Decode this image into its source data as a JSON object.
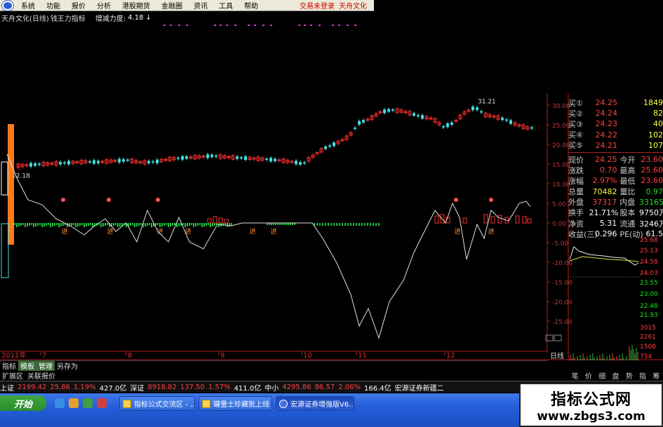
{
  "menu": {
    "items": [
      "系统",
      "功能",
      "报价",
      "分析",
      "港股期货",
      "金融圈",
      "资讯",
      "工具",
      "帮助"
    ],
    "right": [
      "交易未登录",
      "天舟文化"
    ]
  },
  "title": {
    "stock": "天舟文化(日线)",
    "indicator": "钱王力指标",
    "label": "增减力度:",
    "value": "4.18",
    "arrow": "↓"
  },
  "chart": {
    "price_high": "31.21",
    "price_low": "12.18",
    "axis_ticks": [
      "30.00",
      "25.00",
      "20.00",
      "15.00",
      "10.00",
      "5.00",
      "0.00",
      "-5.00",
      "-10.00",
      "-15.00",
      "-20.00",
      "-25.00"
    ],
    "year": "2011年",
    "months": [
      "7",
      "8",
      "9",
      "10",
      "11",
      "12"
    ],
    "period": "日线",
    "buy_marker": "进"
  },
  "quote": {
    "rows": [
      {
        "l": "买①",
        "v": "24.25",
        "c": "1849"
      },
      {
        "l": "买②",
        "v": "24.24",
        "c": "82"
      },
      {
        "l": "买③",
        "v": "24.23",
        "c": "40"
      },
      {
        "l": "买④",
        "v": "24.22",
        "c": "102"
      },
      {
        "l": "买⑤",
        "v": "24.21",
        "c": "107"
      }
    ],
    "stats": [
      {
        "l": "现价",
        "v": "24.25",
        "l2": "今开",
        "v2": "23.60"
      },
      {
        "l": "涨跌",
        "v": "0.70",
        "l2": "最高",
        "v2": "25.60"
      },
      {
        "l": "涨幅",
        "v": "2.97%",
        "l2": "最低",
        "v2": "23.60"
      },
      {
        "l": "总量",
        "v": "70482",
        "l2": "量比",
        "v2": "0.97"
      },
      {
        "l": "外盘",
        "v": "37317",
        "l2": "内盘",
        "v2": "33165"
      },
      {
        "l": "换手",
        "v": "21.71%",
        "l2": "股本",
        "v2": "9750万"
      },
      {
        "l": "净资",
        "v": "5.31",
        "l2": "流通",
        "v2": "3246万"
      },
      {
        "l": "收益(三)",
        "v": "0.296",
        "l2": "PE(动)",
        "v2": "61.5"
      }
    ],
    "mini_ticks": [
      "25.68",
      "25.13",
      "24.58",
      "24.03",
      "23.55",
      "23.00",
      "22.48",
      "21.93",
      "3015",
      "2261",
      "1508",
      "754"
    ]
  },
  "tabs1": [
    "指标",
    "模板",
    "管理",
    "另存为"
  ],
  "tabs2": [
    "扩展区",
    "关联报价"
  ],
  "right_tabs": [
    "笔",
    "价",
    "细",
    "盘",
    "势",
    "指",
    "筹"
  ],
  "status": [
    {
      "t": "上证",
      "c": "wht"
    },
    {
      "t": "2199.42",
      "c": "red"
    },
    {
      "t": "25.86",
      "c": "red"
    },
    {
      "t": "1.19%",
      "c": "red"
    },
    {
      "t": "427.0亿",
      "c": "wht"
    },
    {
      "t": "深证",
      "c": "wht"
    },
    {
      "t": "8918.82",
      "c": "red"
    },
    {
      "t": "137.50",
      "c": "red"
    },
    {
      "t": "1.57%",
      "c": "red"
    },
    {
      "t": "411.0亿",
      "c": "wht"
    },
    {
      "t": "中小",
      "c": "wht"
    },
    {
      "t": "4295.86",
      "c": "red"
    },
    {
      "t": "86.57",
      "c": "red"
    },
    {
      "t": "2.06%",
      "c": "red"
    },
    {
      "t": "166.4亿",
      "c": "wht"
    },
    {
      "t": "宏源证券新疆二",
      "c": "wht"
    }
  ],
  "taskbar": {
    "start": "开始",
    "buttons": [
      "指标公式交流区 - ...",
      "罐量士珍藏批上线",
      "宏源证券增强版V6..."
    ]
  },
  "watermark": {
    "line1": "指标公式网",
    "line2": "www.zbgs3.com"
  },
  "colors": {
    "up": "#ff3030",
    "down": "#40e0e0",
    "line": "#ffffff",
    "axis": "#b02020"
  }
}
